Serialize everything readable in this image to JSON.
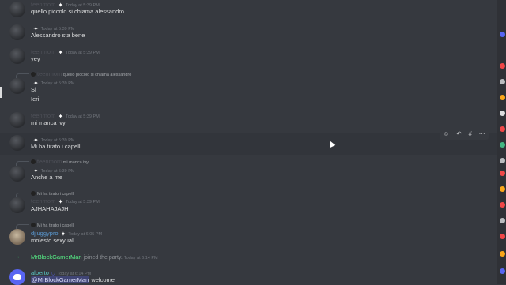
{
  "messages": [
    {
      "author": "teenmom",
      "time": "Today at 5:39 PM",
      "text": "quello piccolo si chiama alessandro"
    },
    {
      "author": "",
      "time": "Today at 5:39 PM",
      "text": "Alessandro sta bene"
    },
    {
      "author": "teenmom",
      "time": "Today at 5:39 PM",
      "text": "yey"
    },
    {
      "reply_author": "teenmom",
      "reply_text": "quello piccolo si chiama alessandro",
      "author": "",
      "time": "Today at 5:39 PM",
      "text": "Si",
      "text2": "Ieri"
    },
    {
      "author": "teenmom",
      "time": "Today at 5:39 PM",
      "text": "mi manca ivy"
    },
    {
      "author": "",
      "time": "Today at 5:39 PM",
      "text": "Mi ha tirato i capelli"
    },
    {
      "reply_author": "teenmom",
      "reply_text": "mi manca ivy",
      "author": "",
      "time": "Today at 5:39 PM",
      "text": "Anche a me"
    },
    {
      "reply_author": "",
      "reply_text": "Mi ha tirato i capelli",
      "author": "teenmom",
      "time": "Today at 5:39 PM",
      "text": "AJHAHAJAJH"
    },
    {
      "reply_author": "",
      "reply_text": "Mi ha tirato i capelli",
      "author": "djjuggypro",
      "time": "Today at 6:05 PM",
      "text": "molesto sexyual"
    },
    {
      "join_user": "MrBlockGamerMan",
      "join_text": "joined the party.",
      "time": "Today at 6:14 PM"
    },
    {
      "author": "alberto",
      "time": "Today at 6:14 PM",
      "mention": "@MrBlockGamerMan",
      "text": "welcome"
    }
  ],
  "icons": {
    "badge": "sparkle-icon",
    "toolbar": [
      "add-reaction-icon",
      "reply-icon",
      "thread-icon",
      "more-icon"
    ]
  },
  "colors": {
    "background": "#36393f",
    "mention_bg": "#5865f2",
    "join_arrow": "#3ba55d"
  }
}
